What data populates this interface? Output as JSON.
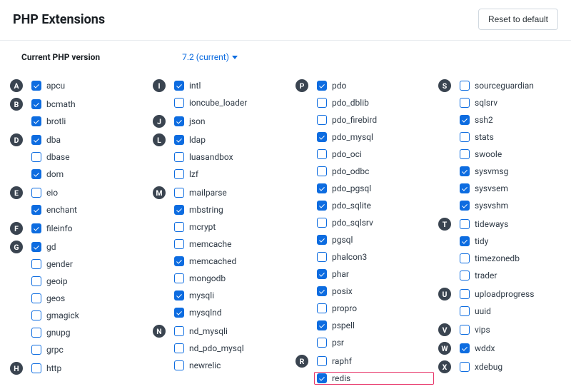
{
  "header": {
    "title": "PHP Extensions",
    "reset_button": "Reset to default"
  },
  "version": {
    "label": "Current PHP version",
    "value": "7.2 (current)"
  },
  "columns": [
    [
      {
        "letter": "A",
        "items": [
          {
            "name": "apcu",
            "checked": true
          }
        ]
      },
      {
        "letter": "B",
        "items": [
          {
            "name": "bcmath",
            "checked": true
          },
          {
            "name": "brotli",
            "checked": true
          }
        ]
      },
      {
        "letter": "D",
        "items": [
          {
            "name": "dba",
            "checked": true
          },
          {
            "name": "dbase",
            "checked": false
          },
          {
            "name": "dom",
            "checked": true
          }
        ]
      },
      {
        "letter": "E",
        "items": [
          {
            "name": "eio",
            "checked": false
          },
          {
            "name": "enchant",
            "checked": true
          }
        ]
      },
      {
        "letter": "F",
        "items": [
          {
            "name": "fileinfo",
            "checked": true
          }
        ]
      },
      {
        "letter": "G",
        "items": [
          {
            "name": "gd",
            "checked": true
          },
          {
            "name": "gender",
            "checked": false
          },
          {
            "name": "geoip",
            "checked": false
          },
          {
            "name": "geos",
            "checked": false
          },
          {
            "name": "gmagick",
            "checked": false
          },
          {
            "name": "gnupg",
            "checked": false
          },
          {
            "name": "grpc",
            "checked": false
          }
        ]
      },
      {
        "letter": "H",
        "items": [
          {
            "name": "http",
            "checked": false
          }
        ]
      }
    ],
    [
      {
        "letter": "I",
        "items": [
          {
            "name": "intl",
            "checked": true
          },
          {
            "name": "ioncube_loader",
            "checked": false
          }
        ]
      },
      {
        "letter": "J",
        "items": [
          {
            "name": "json",
            "checked": true
          }
        ]
      },
      {
        "letter": "L",
        "items": [
          {
            "name": "ldap",
            "checked": true
          },
          {
            "name": "luasandbox",
            "checked": false
          },
          {
            "name": "lzf",
            "checked": false
          }
        ]
      },
      {
        "letter": "M",
        "items": [
          {
            "name": "mailparse",
            "checked": false
          },
          {
            "name": "mbstring",
            "checked": true
          },
          {
            "name": "mcrypt",
            "checked": false
          },
          {
            "name": "memcache",
            "checked": false
          },
          {
            "name": "memcached",
            "checked": true
          },
          {
            "name": "mongodb",
            "checked": false
          },
          {
            "name": "mysqli",
            "checked": true
          },
          {
            "name": "mysqlnd",
            "checked": true
          }
        ]
      },
      {
        "letter": "N",
        "items": [
          {
            "name": "nd_mysqli",
            "checked": false
          },
          {
            "name": "nd_pdo_mysql",
            "checked": false
          },
          {
            "name": "newrelic",
            "checked": false
          }
        ]
      }
    ],
    [
      {
        "letter": "P",
        "items": [
          {
            "name": "pdo",
            "checked": true
          },
          {
            "name": "pdo_dblib",
            "checked": false
          },
          {
            "name": "pdo_firebird",
            "checked": false
          },
          {
            "name": "pdo_mysql",
            "checked": true
          },
          {
            "name": "pdo_oci",
            "checked": false
          },
          {
            "name": "pdo_odbc",
            "checked": false
          },
          {
            "name": "pdo_pgsql",
            "checked": true
          },
          {
            "name": "pdo_sqlite",
            "checked": true
          },
          {
            "name": "pdo_sqlsrv",
            "checked": false
          },
          {
            "name": "pgsql",
            "checked": true
          },
          {
            "name": "phalcon3",
            "checked": false
          },
          {
            "name": "phar",
            "checked": true
          },
          {
            "name": "posix",
            "checked": true
          },
          {
            "name": "propro",
            "checked": false
          },
          {
            "name": "pspell",
            "checked": true
          },
          {
            "name": "psr",
            "checked": false
          }
        ]
      },
      {
        "letter": "R",
        "items": [
          {
            "name": "raphf",
            "checked": false
          },
          {
            "name": "redis",
            "checked": true,
            "highlight": true
          }
        ]
      }
    ],
    [
      {
        "letter": "S",
        "items": [
          {
            "name": "sourceguardian",
            "checked": false
          },
          {
            "name": "sqlsrv",
            "checked": false
          },
          {
            "name": "ssh2",
            "checked": true
          },
          {
            "name": "stats",
            "checked": false
          },
          {
            "name": "swoole",
            "checked": false
          },
          {
            "name": "sysvmsg",
            "checked": true
          },
          {
            "name": "sysvsem",
            "checked": true
          },
          {
            "name": "sysvshm",
            "checked": true
          }
        ]
      },
      {
        "letter": "T",
        "items": [
          {
            "name": "tideways",
            "checked": false
          },
          {
            "name": "tidy",
            "checked": true
          },
          {
            "name": "timezonedb",
            "checked": false
          },
          {
            "name": "trader",
            "checked": false
          }
        ]
      },
      {
        "letter": "U",
        "items": [
          {
            "name": "uploadprogress",
            "checked": false
          },
          {
            "name": "uuid",
            "checked": false
          }
        ]
      },
      {
        "letter": "V",
        "items": [
          {
            "name": "vips",
            "checked": false
          }
        ]
      },
      {
        "letter": "W",
        "items": [
          {
            "name": "wddx",
            "checked": true
          }
        ]
      },
      {
        "letter": "X",
        "items": [
          {
            "name": "xdebug",
            "checked": false
          }
        ]
      }
    ]
  ]
}
